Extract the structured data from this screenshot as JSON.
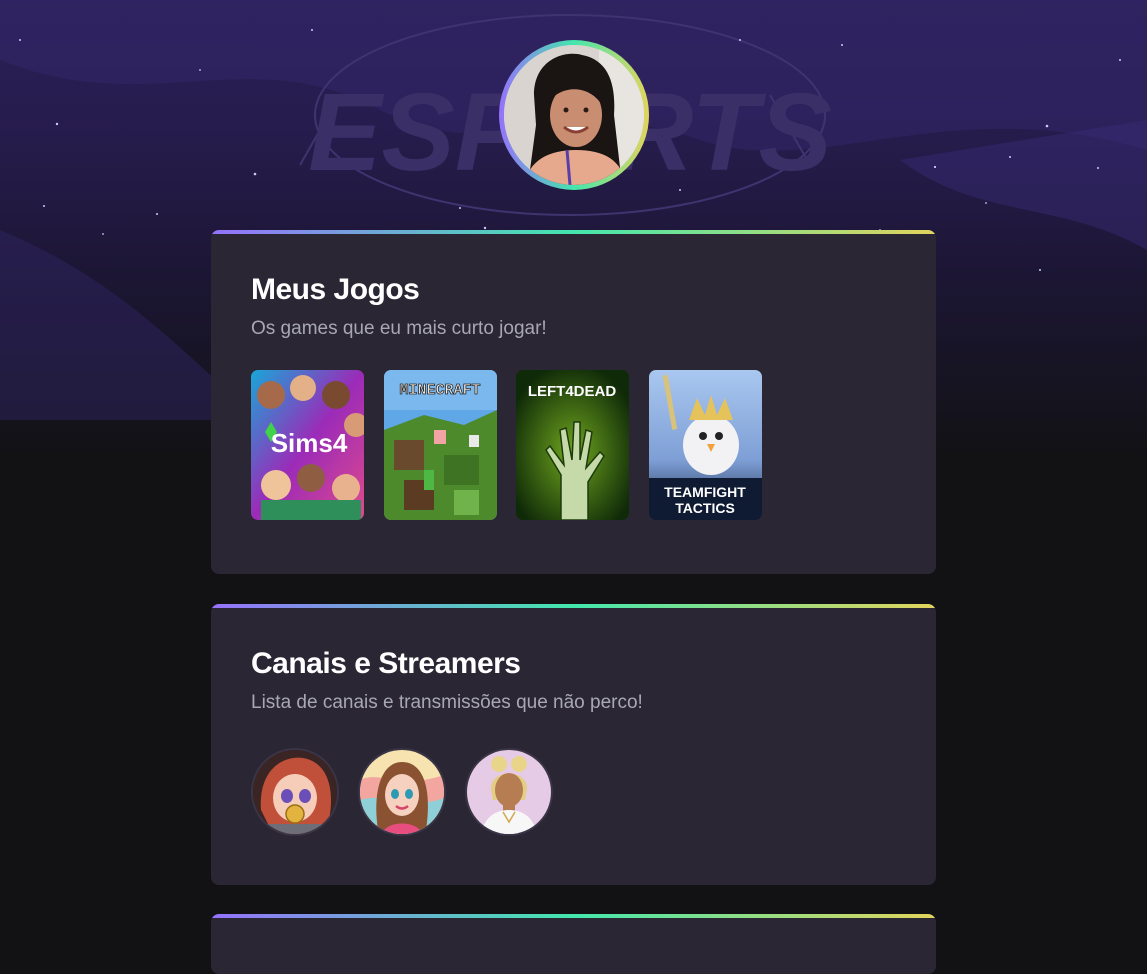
{
  "profile": {
    "avatar_alt": "profile photo"
  },
  "games_section": {
    "title": "Meus Jogos",
    "subtitle": "Os games que eu mais curto jogar!",
    "games": [
      {
        "name": "The Sims 4",
        "cover_text": "Sims4"
      },
      {
        "name": "Minecraft",
        "cover_text": "MINECRAFT"
      },
      {
        "name": "Left 4 Dead",
        "cover_text": "LEFT4DEAD"
      },
      {
        "name": "Teamfight Tactics",
        "cover_text_1": "TEAMFIGHT",
        "cover_text_2": "TACTICS"
      }
    ]
  },
  "streamers_section": {
    "title": "Canais e Streamers",
    "subtitle": "Lista de canais e transmissões que não perco!"
  },
  "colors": {
    "accent_gradient": [
      "#9572fc",
      "#43e7ad",
      "#e2d45c"
    ],
    "card_bg": "#2a2634",
    "page_bg": "#121214"
  }
}
